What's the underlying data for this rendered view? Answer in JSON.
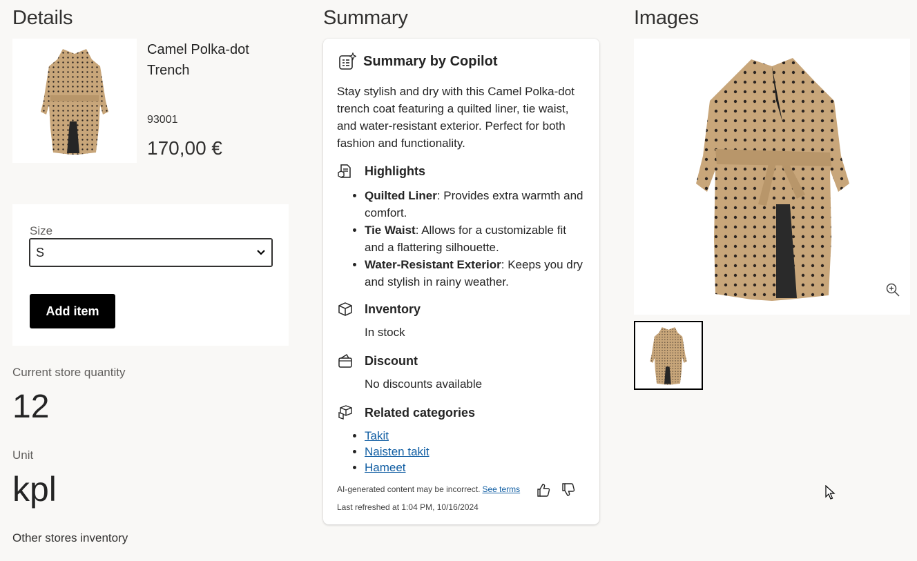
{
  "sections": {
    "details": "Details",
    "summary": "Summary",
    "images": "Images"
  },
  "product": {
    "name": "Camel Polka-dot Trench",
    "sku": "93001",
    "price": "170,00 €"
  },
  "buy": {
    "size_label": "Size",
    "size_value": "S",
    "add_label": "Add item"
  },
  "stock": {
    "qty_label": "Current store quantity",
    "qty_value": "12",
    "unit_label": "Unit",
    "unit_value": "kpl",
    "other_label": "Other stores inventory"
  },
  "copilot": {
    "title": "Summary by Copilot",
    "description": "Stay stylish and dry with this Camel Polka-dot trench coat featuring a quilted liner, tie waist, and water-resistant exterior. Perfect for both fashion and functionality.",
    "highlights_label": "Highlights",
    "highlights": [
      {
        "term": "Quilted Liner",
        "text": ": Provides extra warmth and comfort."
      },
      {
        "term": "Tie Waist",
        "text": ": Allows for a customizable fit and a flattering silhouette."
      },
      {
        "term": "Water-Resistant Exterior",
        "text": ": Keeps you dry and stylish in rainy weather."
      }
    ],
    "inventory_label": "Inventory",
    "inventory_value": "In stock",
    "discount_label": "Discount",
    "discount_value": "No discounts available",
    "categories_label": "Related categories",
    "categories": [
      "Takit",
      "Naisten takit",
      "Hameet"
    ],
    "disclaimer": "AI-generated content may be incorrect.",
    "terms_link": "See terms",
    "refreshed": "Last refreshed at 1:04 PM, 10/16/2024"
  },
  "colors": {
    "coat": "#c8a67a",
    "dots": "#2b2420",
    "accent": "#000000",
    "link": "#115ea3"
  }
}
